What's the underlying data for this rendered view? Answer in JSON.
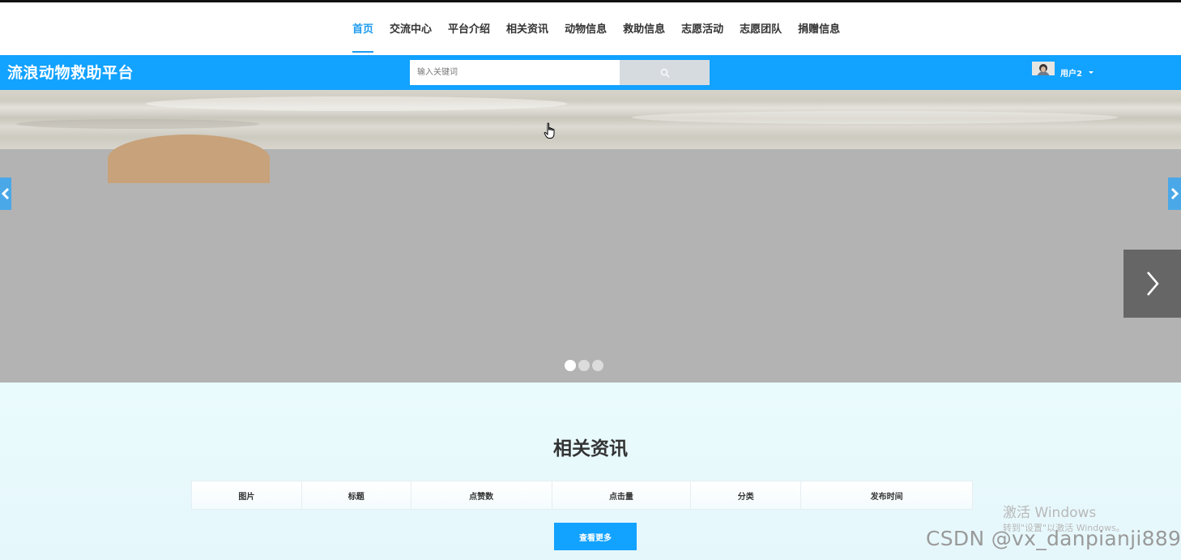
{
  "nav": {
    "items": [
      {
        "label": "首页",
        "active": true
      },
      {
        "label": "交流中心",
        "active": false
      },
      {
        "label": "平台介绍",
        "active": false
      },
      {
        "label": "相关资讯",
        "active": false
      },
      {
        "label": "动物信息",
        "active": false
      },
      {
        "label": "救助信息",
        "active": false
      },
      {
        "label": "志愿活动",
        "active": false
      },
      {
        "label": "志愿团队",
        "active": false
      },
      {
        "label": "捐赠信息",
        "active": false
      }
    ]
  },
  "header": {
    "brand": "流浪动物救助平台",
    "search": {
      "placeholder": "输入关键词",
      "value": "",
      "icon": "search-icon"
    },
    "user": {
      "name": "用户2",
      "icon": "chevron-down-icon"
    }
  },
  "carousel": {
    "slide_count": 3,
    "active_index": 0,
    "icons": {
      "prev": "chevron-left-icon",
      "next": "chevron-right-icon"
    }
  },
  "news": {
    "title": "相关资讯",
    "columns": [
      "图片",
      "标题",
      "点赞数",
      "点击量",
      "分类",
      "发布时间"
    ],
    "rows": [],
    "more_label": "查看更多"
  },
  "watermarks": {
    "windows_line1": "激活 Windows",
    "windows_line2": "转到\"设置\"以激活 Windows。",
    "csdn": "CSDN @vx_danpianji889"
  },
  "colors": {
    "accent": "#12a2ff",
    "nav_active": "#1e9bf0",
    "carousel_bg": "#b3b3b3",
    "section_bg": "#eafbfd"
  }
}
